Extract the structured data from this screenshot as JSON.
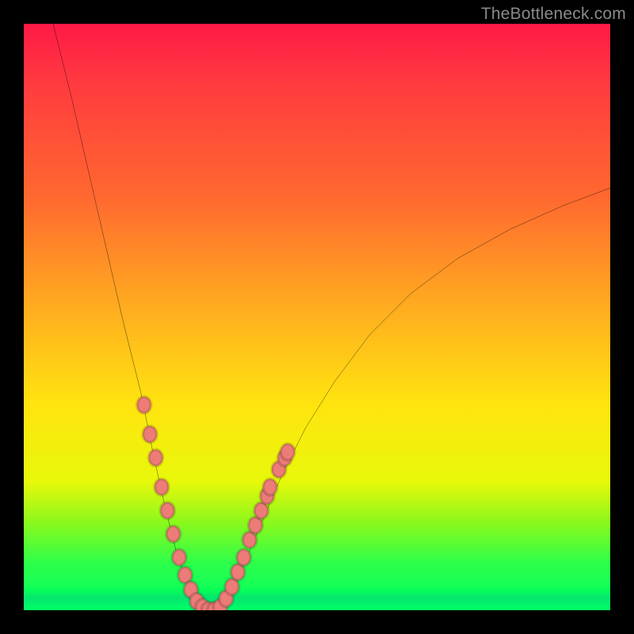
{
  "watermark": "TheBottleneck.com",
  "chart_data": {
    "type": "line",
    "title": "",
    "xlabel": "",
    "ylabel": "",
    "xlim": [
      0,
      100
    ],
    "ylim": [
      0,
      100
    ],
    "grid": false,
    "curve": {
      "name": "bottleneck-curve",
      "points": [
        {
          "x": 5,
          "y": 100
        },
        {
          "x": 8,
          "y": 88
        },
        {
          "x": 11,
          "y": 75
        },
        {
          "x": 14,
          "y": 62
        },
        {
          "x": 17,
          "y": 49
        },
        {
          "x": 20,
          "y": 37
        },
        {
          "x": 22,
          "y": 27
        },
        {
          "x": 24,
          "y": 18
        },
        {
          "x": 26,
          "y": 10
        },
        {
          "x": 28,
          "y": 4
        },
        {
          "x": 30,
          "y": 1
        },
        {
          "x": 32,
          "y": 0
        },
        {
          "x": 34,
          "y": 1
        },
        {
          "x": 36,
          "y": 4
        },
        {
          "x": 38,
          "y": 9
        },
        {
          "x": 41,
          "y": 16
        },
        {
          "x": 44,
          "y": 23
        },
        {
          "x": 48,
          "y": 31
        },
        {
          "x": 53,
          "y": 39
        },
        {
          "x": 59,
          "y": 47
        },
        {
          "x": 66,
          "y": 54
        },
        {
          "x": 74,
          "y": 60
        },
        {
          "x": 83,
          "y": 65
        },
        {
          "x": 92,
          "y": 69
        },
        {
          "x": 100,
          "y": 72
        }
      ]
    },
    "markers": [
      {
        "x": 20.5,
        "y": 35
      },
      {
        "x": 21.5,
        "y": 30
      },
      {
        "x": 22.5,
        "y": 26
      },
      {
        "x": 23.5,
        "y": 21
      },
      {
        "x": 24.5,
        "y": 17
      },
      {
        "x": 25.5,
        "y": 13
      },
      {
        "x": 26.5,
        "y": 9
      },
      {
        "x": 27.5,
        "y": 6
      },
      {
        "x": 28.5,
        "y": 3.5
      },
      {
        "x": 29.5,
        "y": 1.5
      },
      {
        "x": 30.5,
        "y": 0.5
      },
      {
        "x": 31.5,
        "y": 0
      },
      {
        "x": 32.5,
        "y": 0
      },
      {
        "x": 33.5,
        "y": 0.5
      },
      {
        "x": 34.5,
        "y": 2
      },
      {
        "x": 35.5,
        "y": 4
      },
      {
        "x": 36.5,
        "y": 6.5
      },
      {
        "x": 37.5,
        "y": 9
      },
      {
        "x": 38.5,
        "y": 12
      },
      {
        "x": 39.5,
        "y": 14.5
      },
      {
        "x": 40.5,
        "y": 17
      },
      {
        "x": 41.5,
        "y": 19.5
      },
      {
        "x": 42.0,
        "y": 21
      },
      {
        "x": 43.5,
        "y": 24
      },
      {
        "x": 44.5,
        "y": 26
      },
      {
        "x": 45.0,
        "y": 27
      }
    ],
    "marker_color": "#ed7b78",
    "line_color": "#000000",
    "background_gradient": [
      "#ff1a47",
      "#ffb21e",
      "#ffe40f",
      "#2cff4a",
      "#00ff66"
    ]
  }
}
